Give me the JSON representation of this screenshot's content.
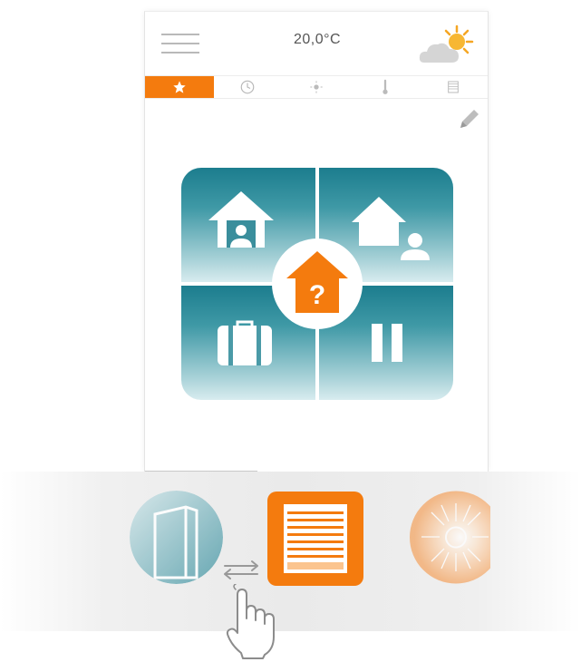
{
  "header": {
    "temperature": "20,0°C",
    "menu_icon": "hamburger-menu-icon",
    "weather_icon": "partly-sunny-icon"
  },
  "tabs": [
    {
      "icon": "star-icon",
      "active": true
    },
    {
      "icon": "clock-icon",
      "active": false
    },
    {
      "icon": "sun-icon",
      "active": false
    },
    {
      "icon": "thermometer-icon",
      "active": false
    },
    {
      "icon": "shutter-icon",
      "active": false
    }
  ],
  "scene_grid": {
    "tiles": [
      "home-present-icon",
      "away-from-home-icon",
      "vacation-suitcase-icon",
      "pause-icon"
    ],
    "center_icon": "house-question-icon",
    "center_glyph": "?"
  },
  "mode_carousel": {
    "items": [
      "door-icon",
      "window-blind-icon",
      "sunlight-icon"
    ],
    "selected": "window-blind-icon"
  },
  "colors": {
    "accent": "#f47b0e",
    "tile_top": "#1c7d8e",
    "tile_bottom": "#d8ecef"
  }
}
